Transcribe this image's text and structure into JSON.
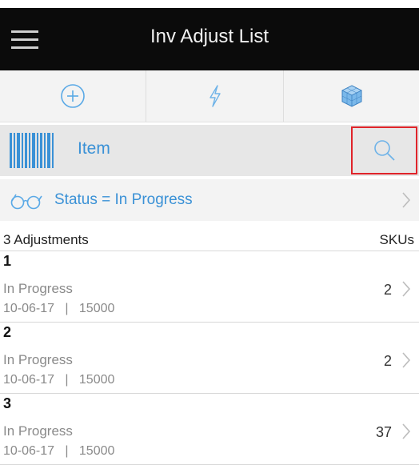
{
  "header": {
    "title": "Inv Adjust List"
  },
  "toolbar": {
    "icons": [
      "plus-circle-icon",
      "lightning-icon",
      "cube-icon"
    ]
  },
  "search": {
    "label": "Item"
  },
  "filter": {
    "text": "Status = In Progress"
  },
  "list": {
    "count_label": "3 Adjustments",
    "skus_label": "SKUs",
    "rows": [
      {
        "id": "1",
        "status": "In Progress",
        "date": "10-06-17",
        "sep": "|",
        "code": "15000",
        "skus": "2"
      },
      {
        "id": "2",
        "status": "In Progress",
        "date": "10-06-17",
        "sep": "|",
        "code": "15000",
        "skus": "2"
      },
      {
        "id": "3",
        "status": "In Progress",
        "date": "10-06-17",
        "sep": "|",
        "code": "15000",
        "skus": "37"
      }
    ]
  },
  "colors": {
    "titlebar_bg": "#0b0b0b",
    "accent": "#3a91d6",
    "highlight": "#e0242a"
  }
}
